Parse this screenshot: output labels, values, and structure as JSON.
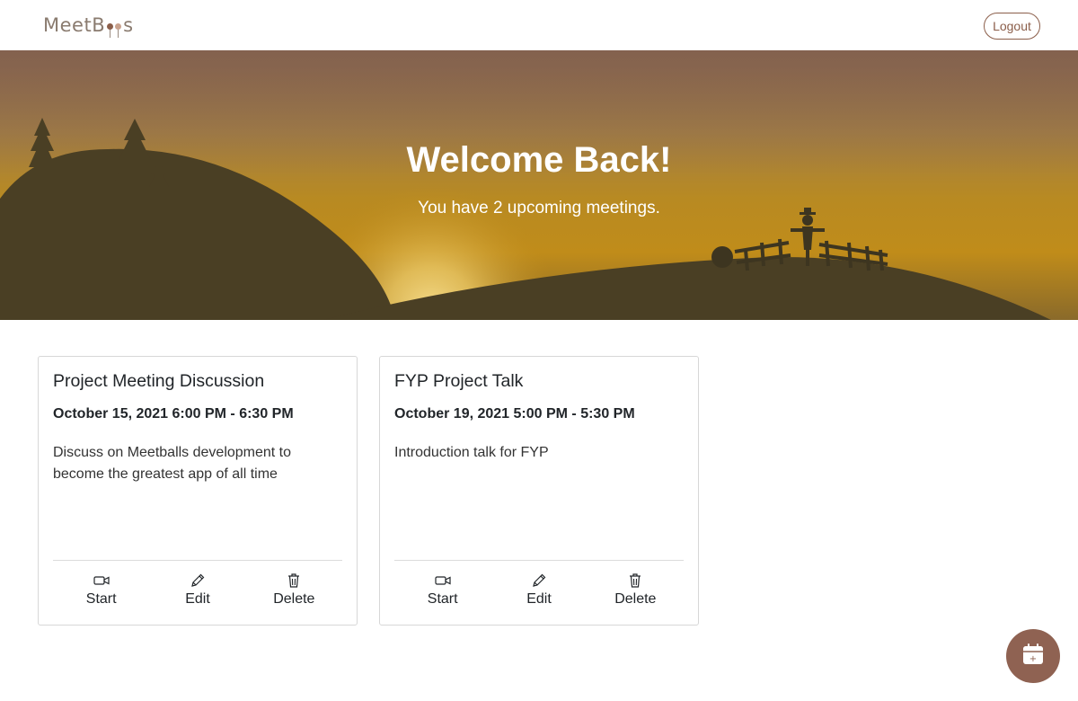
{
  "app": {
    "logo_text_left": "MeetB",
    "logo_text_right": "s"
  },
  "navbar": {
    "logout_label": "Logout"
  },
  "hero": {
    "title": "Welcome Back!",
    "subtitle": "You have 2 upcoming meetings."
  },
  "meetings": [
    {
      "title": "Project Meeting Discussion",
      "time": "October 15, 2021 6:00 PM - 6:30 PM",
      "description": "Discuss on Meetballs development to become the greatest app of all time",
      "actions": {
        "start": "Start",
        "edit": "Edit",
        "delete": "Delete"
      }
    },
    {
      "title": "FYP Project Talk",
      "time": "October 19, 2021 5:00 PM - 5:30 PM",
      "description": "Introduction talk for FYP",
      "actions": {
        "start": "Start",
        "edit": "Edit",
        "delete": "Delete"
      }
    }
  ],
  "fab": {
    "icon": "calendar-plus-icon",
    "glyph": "+"
  },
  "colors": {
    "accent": "#8f6252",
    "hero_sky_top": "#8c6a52",
    "hero_sky_mid": "#c08c1a",
    "hill": "#4a3f24"
  }
}
